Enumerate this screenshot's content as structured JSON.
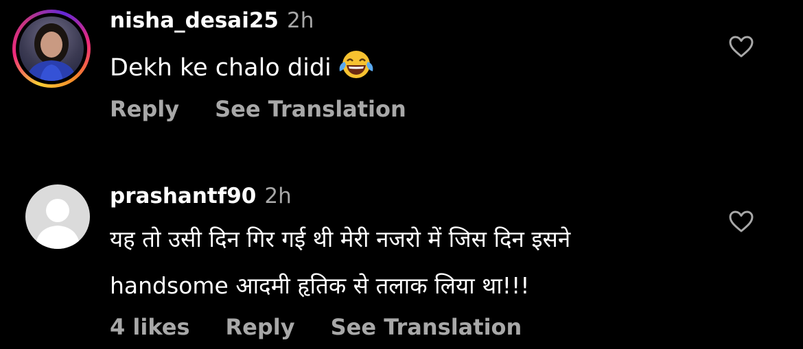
{
  "comments": [
    {
      "username": "nisha_desai25",
      "time": "2h",
      "text_line1": "Dekh ke chalo didi",
      "emoji": "face-with-tears-of-joy",
      "actions": {
        "reply": "Reply",
        "translate": "See Translation"
      },
      "avatar": "story-ring-photo",
      "liked": false
    },
    {
      "username": "prashantf90",
      "time": "2h",
      "text_line1": "यह तो उसी दिन गिर गई थी मेरी नजरो में जिस दिन इसने",
      "text_line2": "handsome आदमी हृतिक से तलाक लिया था!!!",
      "actions": {
        "likes": "4 likes",
        "reply": "Reply",
        "translate": "See Translation"
      },
      "avatar": "default-avatar",
      "liked": false
    }
  ],
  "colors": {
    "background": "#000000",
    "primary_text": "#ffffff",
    "secondary_text": "#a8a8a8",
    "default_avatar": "#dbdbdb"
  },
  "icons": {
    "like": "heart-outline-icon"
  }
}
